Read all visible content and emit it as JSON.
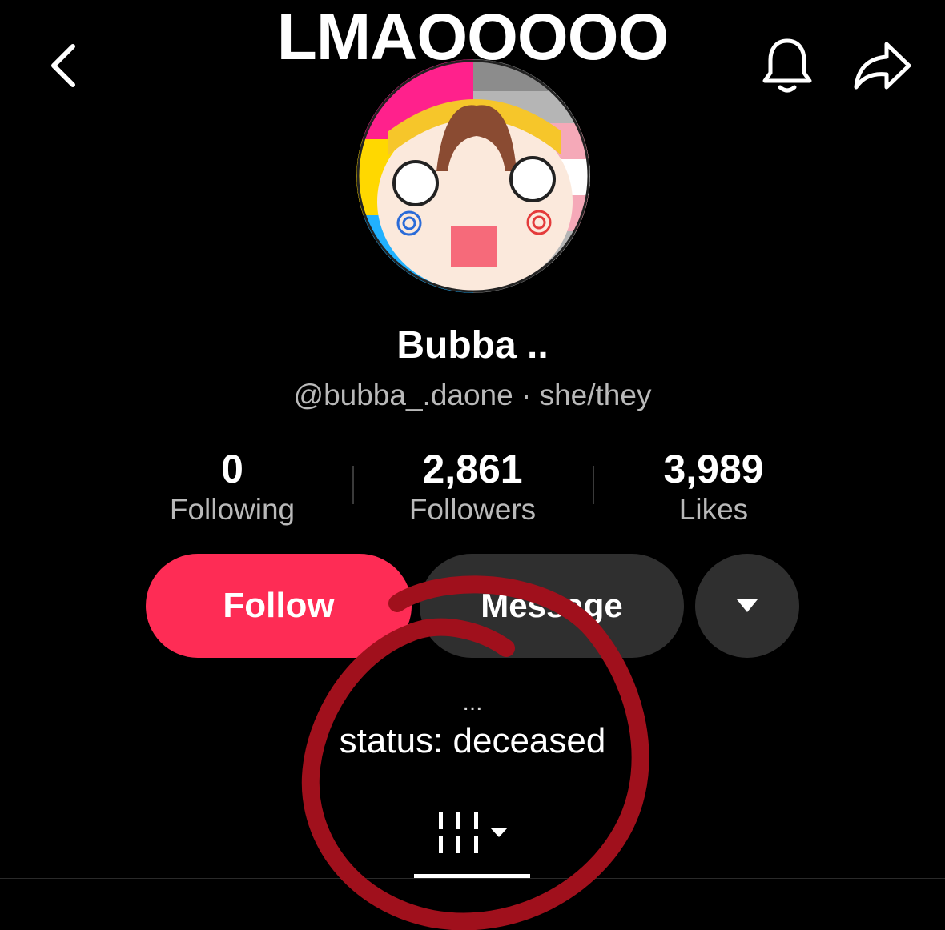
{
  "overlay_caption": "LMAOOOOO",
  "topbar": {
    "back_icon": "chevron-left-icon",
    "bell_icon": "bell-icon",
    "share_icon": "share-arrow-icon"
  },
  "profile": {
    "display_name": "Bubba ..",
    "handle_line": "@bubba_.daone · she/they"
  },
  "stats": [
    {
      "value": "0",
      "label": "Following"
    },
    {
      "value": "2,861",
      "label": "Followers"
    },
    {
      "value": "3,989",
      "label": "Likes"
    }
  ],
  "actions": {
    "follow_label": "Follow",
    "message_label": "Message",
    "more_icon": "caret-down-icon"
  },
  "bio": {
    "dots": "...",
    "text": "status: deceased"
  },
  "tabs": {
    "videos_icon": "grid-bars-icon"
  },
  "colors": {
    "accent": "#fe2c55",
    "annotation": "#a0101c",
    "secondary_button": "#2f2f2f"
  }
}
